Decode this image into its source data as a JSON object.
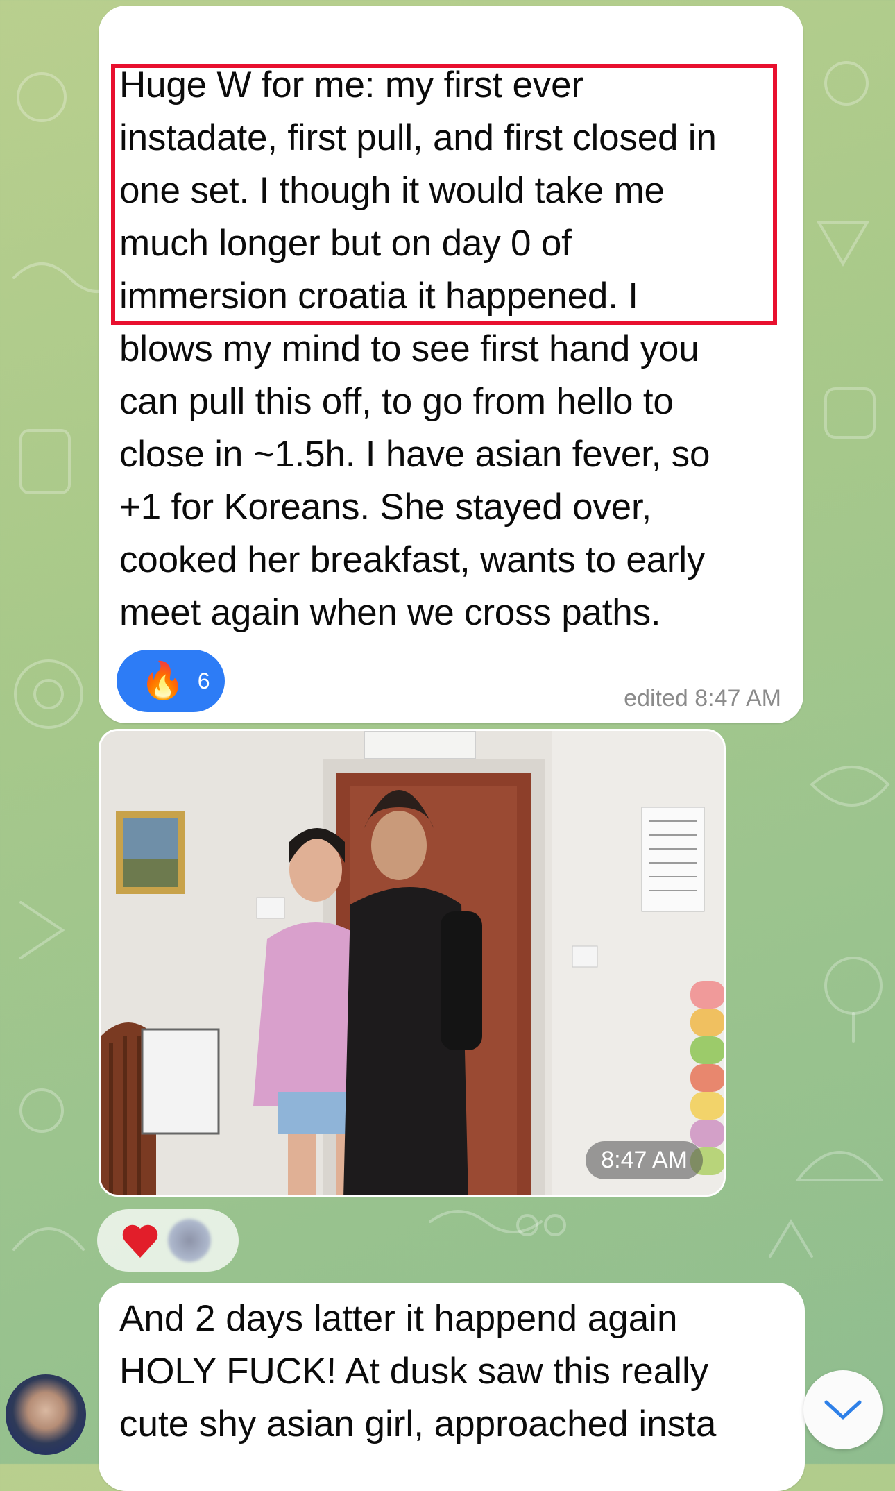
{
  "messages": [
    {
      "highlighted_text": "Huge W for me: my first ever\ninstadate, first pull, and first closed in\none set. I though it would take me\nmuch longer but on day 0 of\nimmersion croatia it happened.",
      "rest_text": " I\nblows my mind to see first hand you\ncan pull this off, to go from hello to\nclose in ~1.5h. I have asian fever, so\n+1 for Koreans. She stayed over,\ncooked her breakfast, wants to early\nmeet again when we cross paths.",
      "reaction": {
        "emoji": "🔥",
        "count": "6",
        "color": "#2d7cf6"
      },
      "meta": "edited 8:47 AM"
    },
    {
      "photo_time": "8:47 AM",
      "reaction_emoji": "❤️"
    },
    {
      "text": "And 2 days latter it happend again\nHOLY FUCK! At dusk saw this really\ncute shy asian girl, approached insta"
    }
  ],
  "colors": {
    "highlight": "#e8102e",
    "accent": "#2d7cf6"
  },
  "icons": {
    "scroll_down": "chevron-down-icon"
  }
}
